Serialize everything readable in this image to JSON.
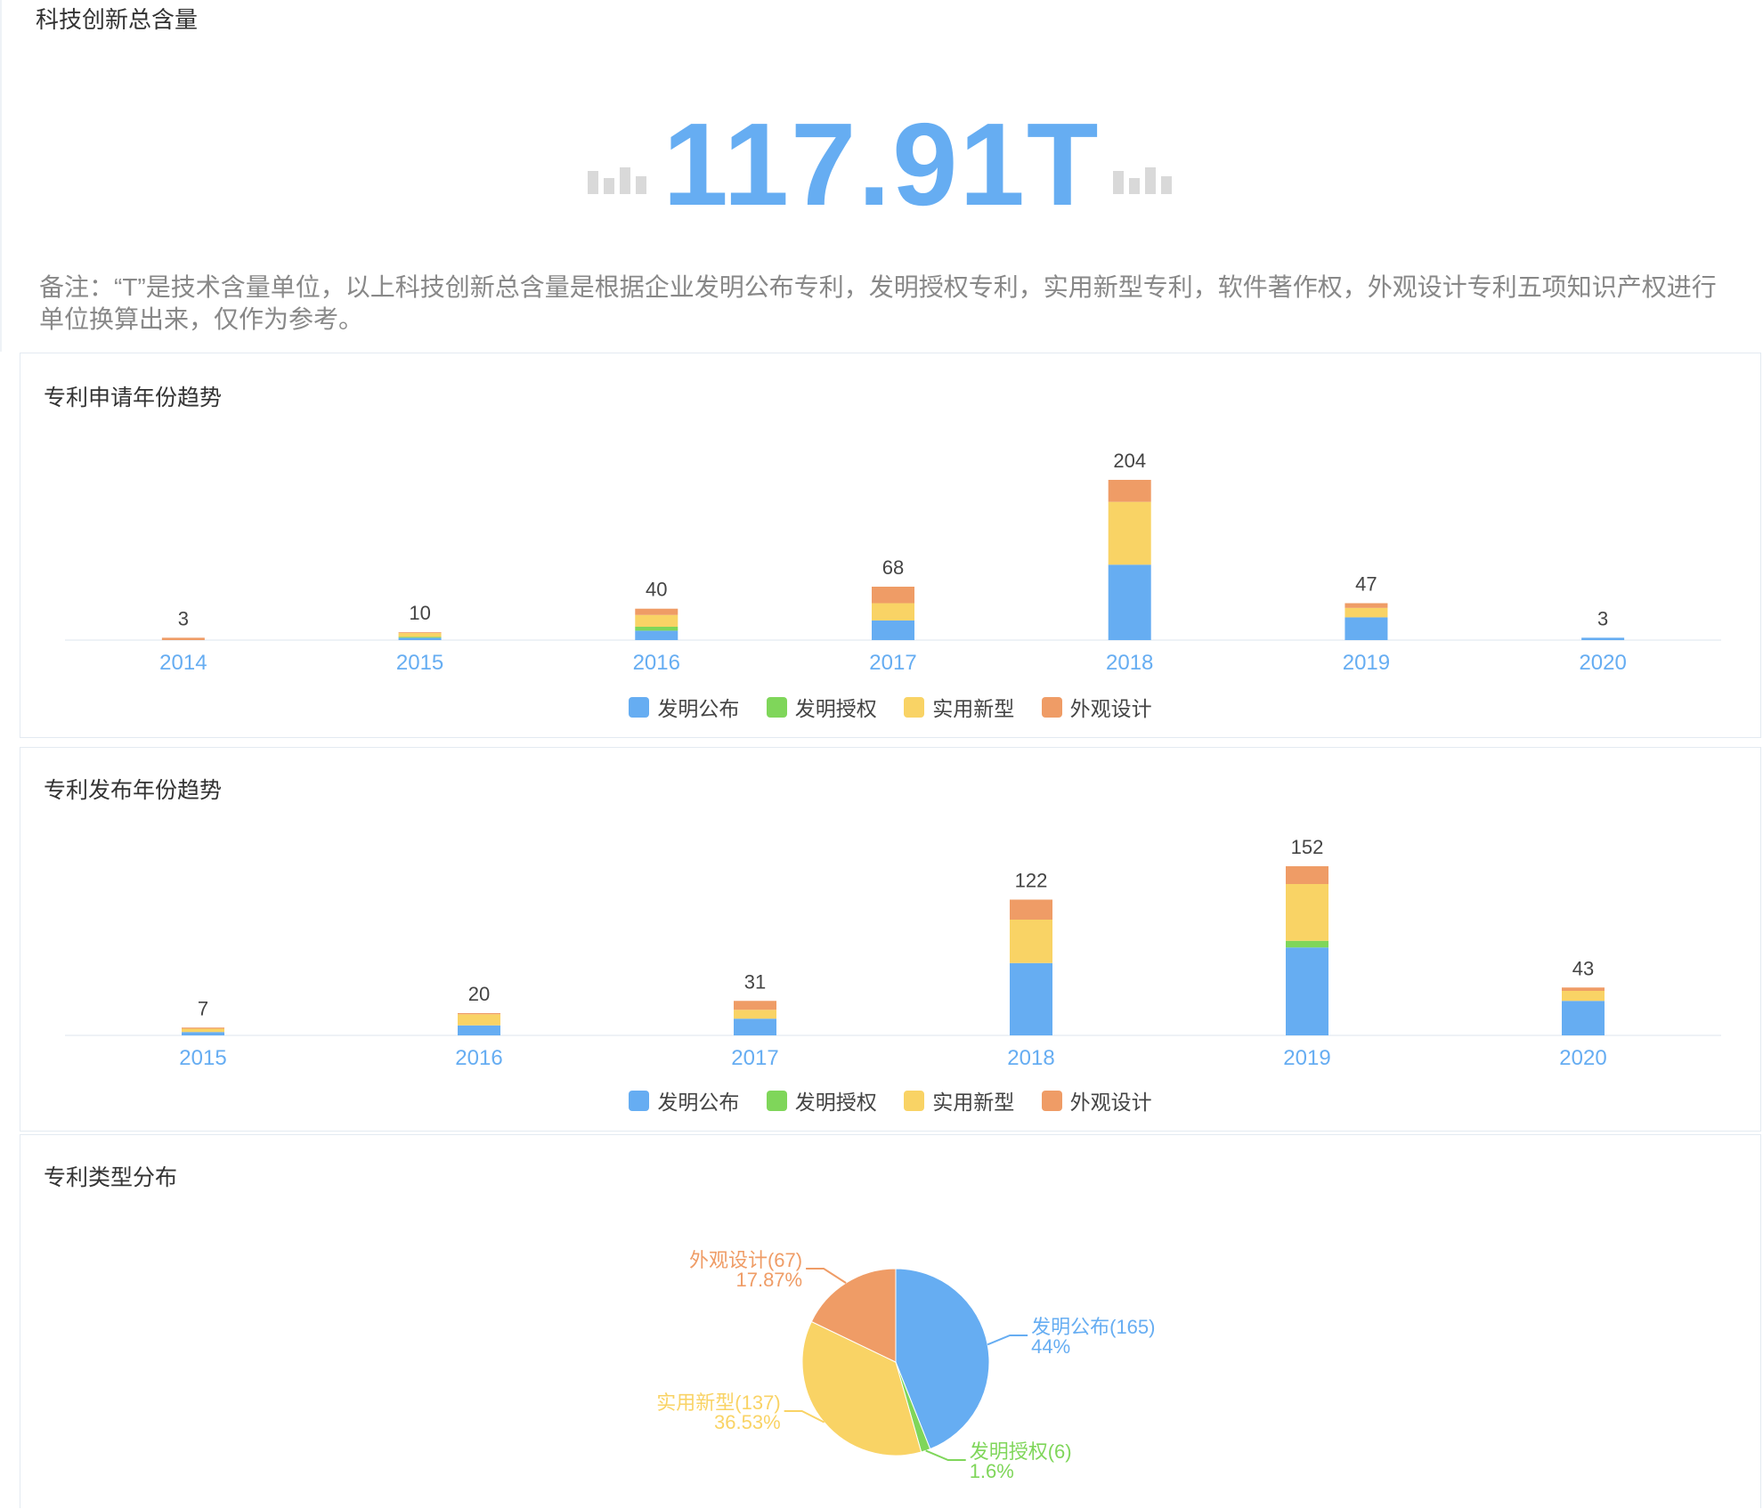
{
  "metric": {
    "title": "科技创新总含量",
    "value": "117.91T",
    "note": "备注：“T”是技术含量单位，以上科技创新总含量是根据企业发明公布专利，发明授权专利，实用新型专利，软件著作权，外观设计专利五项知识产权进行单位换算出来，仅作为参考。"
  },
  "colors": {
    "发明公布": "#66adf2",
    "发明授权": "#7fd65a",
    "实用新型": "#f9d365",
    "外观设计": "#ef9c66",
    "axis_label": "#66adf2"
  },
  "chart_data": [
    {
      "type": "bar",
      "stacked": true,
      "title": "专利申请年份趋势",
      "categories": [
        "2014",
        "2015",
        "2016",
        "2017",
        "2018",
        "2019",
        "2020"
      ],
      "totals": [
        3,
        10,
        40,
        68,
        204,
        47,
        3
      ],
      "series": [
        {
          "name": "发明公布",
          "values": [
            0,
            3,
            12,
            25,
            96,
            29,
            3
          ]
        },
        {
          "name": "发明授权",
          "values": [
            0,
            1,
            5,
            0,
            0,
            0,
            0
          ]
        },
        {
          "name": "实用新型",
          "values": [
            0,
            5,
            15,
            22,
            80,
            12,
            0
          ]
        },
        {
          "name": "外观设计",
          "values": [
            3,
            1,
            8,
            21,
            28,
            6,
            0
          ]
        }
      ],
      "legend": "bottom",
      "grid": false
    },
    {
      "type": "bar",
      "stacked": true,
      "title": "专利发布年份趋势",
      "categories": [
        "2015",
        "2016",
        "2017",
        "2018",
        "2019",
        "2020"
      ],
      "totals": [
        7,
        20,
        31,
        122,
        152,
        43
      ],
      "series": [
        {
          "name": "发明公布",
          "values": [
            3,
            9,
            15,
            65,
            79,
            31
          ]
        },
        {
          "name": "发明授权",
          "values": [
            0,
            0,
            0,
            0,
            6,
            0
          ]
        },
        {
          "name": "实用新型",
          "values": [
            3,
            10,
            8,
            39,
            51,
            9
          ]
        },
        {
          "name": "外观设计",
          "values": [
            1,
            1,
            8,
            18,
            16,
            3
          ]
        }
      ],
      "legend": "bottom",
      "grid": false
    },
    {
      "type": "pie",
      "title": "专利类型分布",
      "slices": [
        {
          "name": "发明公布",
          "value": 165,
          "label": "发明公布(165)",
          "percent": "44%"
        },
        {
          "name": "发明授权",
          "value": 6,
          "label": "发明授权(6)",
          "percent": "1.6%"
        },
        {
          "name": "实用新型",
          "value": 137,
          "label": "实用新型(137)",
          "percent": "36.53%"
        },
        {
          "name": "外观设计",
          "value": 67,
          "label": "外观设计(67)",
          "percent": "17.87%"
        }
      ]
    }
  ]
}
